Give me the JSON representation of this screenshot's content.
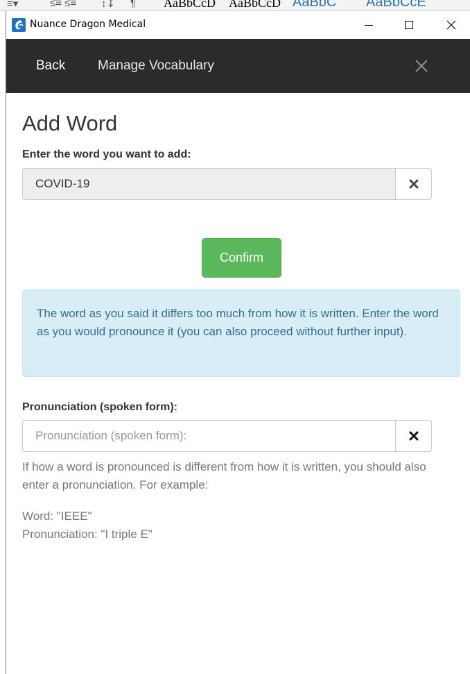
{
  "background_window": {
    "ribbon_fragments": [
      "≡▾",
      "≤≡ ≤≡",
      "↕↧",
      "¶"
    ],
    "style_samples": [
      "AaBbCcD ",
      "AaBbCcD ",
      "AaBbC ",
      "AaBbCcE"
    ]
  },
  "window": {
    "title": "Nuance Dragon Medical",
    "minimize_glyph": "—",
    "maximize_glyph": "☐",
    "close_glyph": "✕"
  },
  "nav": {
    "back_label": "Back",
    "manage_label": "Manage Vocabulary",
    "close_icon": "close-icon"
  },
  "page": {
    "title": "Add Word"
  },
  "word_field": {
    "label": "Enter the word you want to add:",
    "value": "COVID-19",
    "clear_icon": "clear-x-icon"
  },
  "confirm_label": "Confirm",
  "alert_text": "The word as you said it differs too much from how it is written. Enter the word as you would pronounce it (you can also proceed without further input).",
  "pronunciation_field": {
    "label": "Pronunciation (spoken form):",
    "value": "",
    "placeholder": "Pronunciation (spoken form):",
    "clear_icon": "clear-x-icon"
  },
  "help_text": "If how a word is pronounced is different from how it is written, you should also enter a pronunciation. For example:",
  "example": {
    "word_line": "Word: \"IEEE\"",
    "pronunciation_line": "Pronunciation: \"I triple E\""
  },
  "colors": {
    "navbar_bg": "#2b2b2b",
    "confirm_bg": "#5cb85c",
    "alert_bg": "#d9edf7",
    "alert_text": "#31708f",
    "app_icon": "#1e73be"
  }
}
